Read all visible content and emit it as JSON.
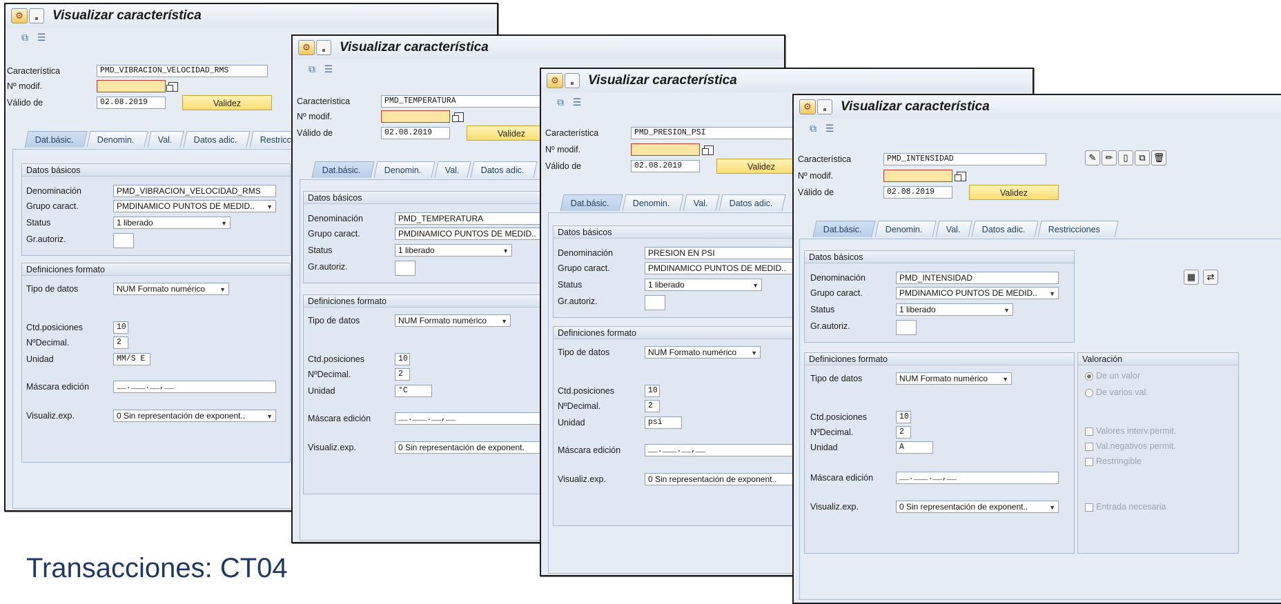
{
  "window_title": "Visualizar característica",
  "labels": {
    "caracteristica": "Característica",
    "n_modif": "Nº modif.",
    "valido_de": "Válido de",
    "validez_button": "Validez",
    "datos_basicos": "Datos básicos",
    "denominacion": "Denominación",
    "grupo_caract": "Grupo caract.",
    "status": "Status",
    "gr_autoriz": "Gr.autoriz.",
    "definiciones_formato": "Definiciones formato",
    "tipo_de_datos": "Tipo de datos",
    "ctd_posiciones": "Ctd.posiciones",
    "no_decimal": "NºDecimal.",
    "unidad": "Unidad",
    "mascara_edicion": "Máscara edición",
    "visualiz_exp": "Visualiz.exp.",
    "valoracion": "Valoración",
    "de_un_valor": "De un valor",
    "de_varios_val": "De varios val.",
    "valores_interv": "Valores interv.permit.",
    "val_negativos": "Val.negativos permit.",
    "restringible": "Restringible",
    "entrada_necesaria": "Entrada necesaria"
  },
  "tabs": [
    "Dat.básic.",
    "Denomin.",
    "Val.",
    "Datos adic.",
    "Restricciones"
  ],
  "tab_cut_w1": "Restricc",
  "windows": [
    {
      "caracteristica": "PMD_VIBRACION_VELOCIDAD_RMS",
      "valido_de": "02.08.2019",
      "denominacion": "PMD_VIBRACION_VELOCIDAD_RMS",
      "grupo_caract": "PMDINAMICO PUNTOS DE MEDID..",
      "status": "1 liberado",
      "tipo_de_datos": "NUM Formato numérico",
      "ctd_posiciones": "10",
      "no_decimal": "2",
      "unidad": "MM/S E",
      "mascara": "__.___.__,__",
      "visualiz_exp": "0 Sin representación de exponent.."
    },
    {
      "caracteristica": "PMD_TEMPERATURA",
      "valido_de": "02.08.2019",
      "denominacion": "PMD_TEMPERATURA",
      "grupo_caract": "PMDINAMICO PUNTOS DE MEDID..",
      "status": "1 liberado",
      "tipo_de_datos": "NUM Formato numérico",
      "ctd_posiciones": "10",
      "no_decimal": "2",
      "unidad": "°C",
      "mascara": "__.___.__,__",
      "visualiz_exp": "0 Sin representación de exponent."
    },
    {
      "caracteristica": "PMD_PRESION_PSI",
      "valido_de": "02.08.2019",
      "denominacion": "PRESION EN PSI",
      "grupo_caract": "PMDINAMICO PUNTOS DE MEDID..",
      "status": "1 liberado",
      "tipo_de_datos": "NUM Formato numérico",
      "ctd_posiciones": "10",
      "no_decimal": "2",
      "unidad": "psi",
      "mascara": "__.___.__,__",
      "visualiz_exp": "0 Sin representación de exponent.."
    },
    {
      "caracteristica": "PMD_INTENSIDAD",
      "valido_de": "02.08.2019",
      "denominacion": "PMD_INTENSIDAD",
      "grupo_caract": "PMDINAMICO PUNTOS DE MEDID..",
      "status": "1 liberado",
      "tipo_de_datos": "NUM Formato numérico",
      "ctd_posiciones": "10",
      "no_decimal": "2",
      "unidad": "A",
      "mascara": "__.___.__,__",
      "visualiz_exp": "0 Sin representación de exponent.."
    }
  ],
  "caption": "Transacciones: CT04",
  "icons": {
    "app": "sap-app-icon",
    "menu": "window-menu-icon",
    "tb1": "other-characteristic-icon",
    "tb2": "hierarchy-icon"
  }
}
